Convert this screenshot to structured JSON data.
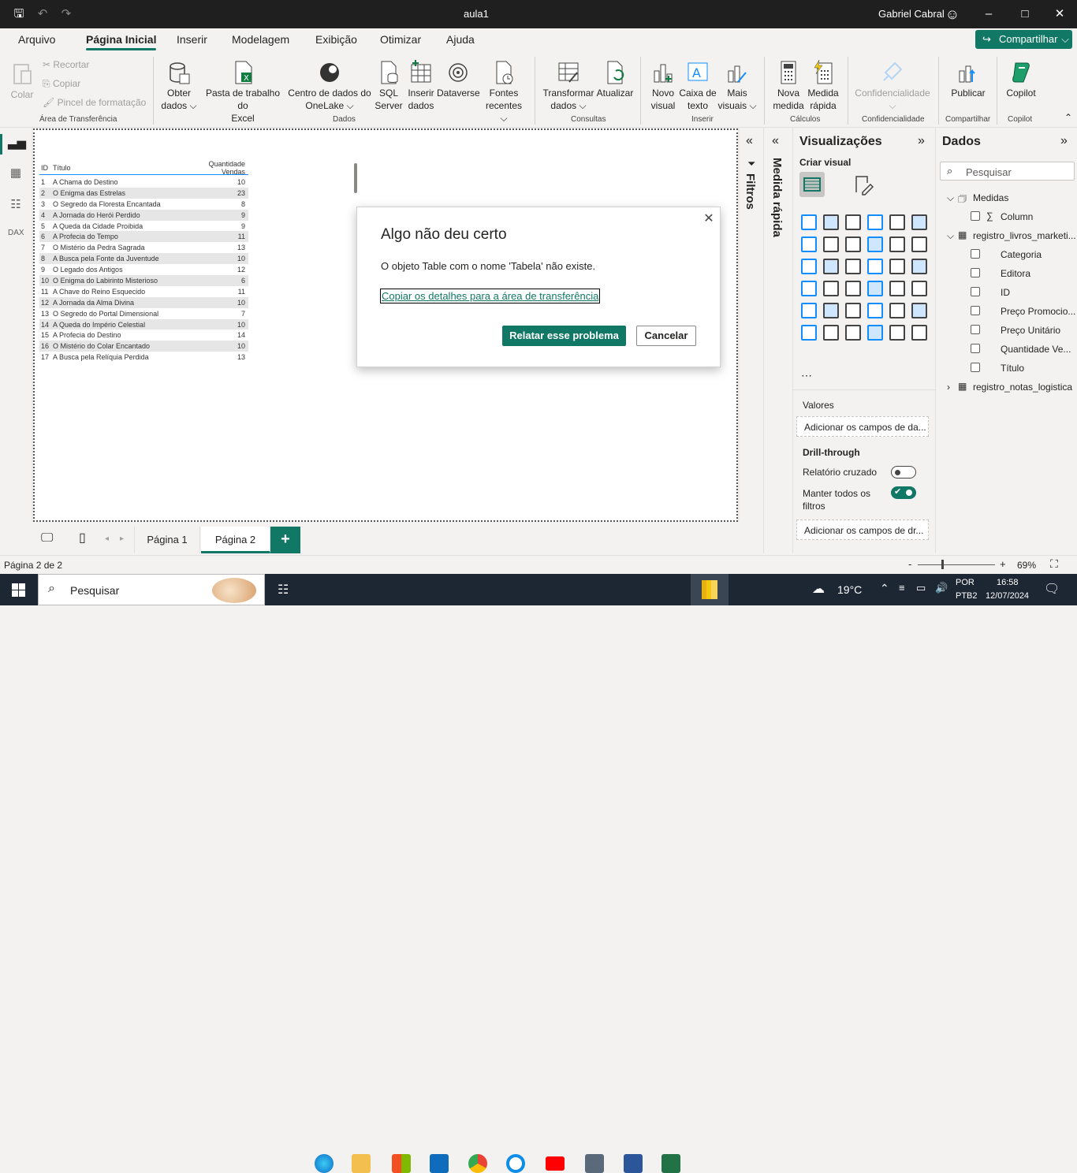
{
  "app": {
    "doc_title": "aula1",
    "user": "Gabriel Cabral"
  },
  "menu": [
    "Arquivo",
    "Página Inicial",
    "Inserir",
    "Modelagem",
    "Exibição",
    "Otimizar",
    "Ajuda"
  ],
  "share_label": "Compartilhar",
  "ribbon": {
    "clipboard": {
      "paste": "Colar",
      "cut": "Recortar",
      "copy": "Copiar",
      "format": "Pincel de formatação",
      "group": "Área de Transferência"
    },
    "data": {
      "get1": "Obter",
      "get2": "dados",
      "excel1": "Pasta de trabalho do",
      "excel2": "Excel",
      "onelake1": "Centro de dados do",
      "onelake2": "OneLake",
      "sql1": "SQL",
      "sql2": "Server",
      "enter1": "Inserir",
      "enter2": "dados",
      "dataverse": "Dataverse",
      "recent1": "Fontes",
      "recent2": "recentes",
      "group": "Dados"
    },
    "queries": {
      "transform1": "Transformar",
      "transform2": "dados",
      "refresh": "Atualizar",
      "group": "Consultas"
    },
    "insert": {
      "newvis1": "Novo",
      "newvis2": "visual",
      "textbox1": "Caixa de",
      "textbox2": "texto",
      "more1": "Mais",
      "more2": "visuais",
      "group": "Inserir"
    },
    "calc": {
      "newmeasure1": "Nova",
      "newmeasure2": "medida",
      "quick1": "Medida",
      "quick2": "rápida",
      "group": "Cálculos"
    },
    "sens": {
      "label": "Confidencialidade",
      "group": "Confidencialidade"
    },
    "share": {
      "publish": "Publicar",
      "group": "Compartilhar"
    },
    "copilot": {
      "label": "Copilot",
      "group": "Copilot"
    }
  },
  "table": {
    "headers": [
      "ID",
      "Título",
      "Quantidade Vendas"
    ],
    "rows": [
      [
        "1",
        "A Chama do Destino",
        "10"
      ],
      [
        "2",
        "O Enigma das Estrelas",
        "23"
      ],
      [
        "3",
        "O Segredo da Floresta Encantada",
        "8"
      ],
      [
        "4",
        "A Jornada do Herói Perdido",
        "9"
      ],
      [
        "5",
        "A Queda da Cidade Proibida",
        "9"
      ],
      [
        "6",
        "A Profecia do Tempo",
        "11"
      ],
      [
        "7",
        "O Mistério da Pedra Sagrada",
        "13"
      ],
      [
        "8",
        "A Busca pela Fonte da Juventude",
        "10"
      ],
      [
        "9",
        "O Legado dos Antigos",
        "12"
      ],
      [
        "10",
        "O Enigma do Labirinto Misterioso",
        "6"
      ],
      [
        "11",
        "A Chave do Reino Esquecido",
        "11"
      ],
      [
        "12",
        "A Jornada da Alma Divina",
        "10"
      ],
      [
        "13",
        "O Segredo do Portal Dimensional",
        "7"
      ],
      [
        "14",
        "A Queda do Império Celestial",
        "10"
      ],
      [
        "15",
        "A Profecia do Destino",
        "14"
      ],
      [
        "16",
        "O Mistério do Colar Encantado",
        "10"
      ],
      [
        "17",
        "A Busca pela Relíquia Perdida",
        "13"
      ]
    ]
  },
  "dialog": {
    "title": "Algo não deu certo",
    "message": "O objeto Table com o nome 'Tabela' não existe.",
    "link": "Copiar os detalhes para a área de transferência",
    "report": "Relatar esse problema",
    "cancel": "Cancelar"
  },
  "panes": {
    "filters": "Filtros",
    "quick": "Medida rápida",
    "viz_title": "Visualizações",
    "create_visual": "Criar visual",
    "values": "Valores",
    "add_fields": "Adicionar os campos de da...",
    "drill": "Drill-through",
    "cross": "Relatório cruzado",
    "keep1": "Manter todos os",
    "keep2": "filtros",
    "add_drill": "Adicionar os campos de dr...",
    "data_title": "Dados",
    "search": "Pesquisar",
    "measures": "Medidas",
    "column": "Column",
    "table1": "registro_livros_marketi...",
    "fields": [
      "Categoria",
      "Editora",
      "ID",
      "Preço Promocio...",
      "Preço Unitário",
      "Quantidade Ve...",
      "Título"
    ],
    "table2": "registro_notas_logistica"
  },
  "pages": [
    "Página 1",
    "Página 2"
  ],
  "status": {
    "page": "Página 2 de 2",
    "zoom": "69%"
  },
  "taskbar": {
    "search": "Pesquisar",
    "temp": "19°C",
    "lang1": "POR",
    "lang2": "PTB2",
    "time": "16:58",
    "date": "12/07/2024"
  },
  "colors": {
    "accent": "#117865",
    "title_bg": "#1f1f1f",
    "taskbar_bg": "#1c2733"
  }
}
